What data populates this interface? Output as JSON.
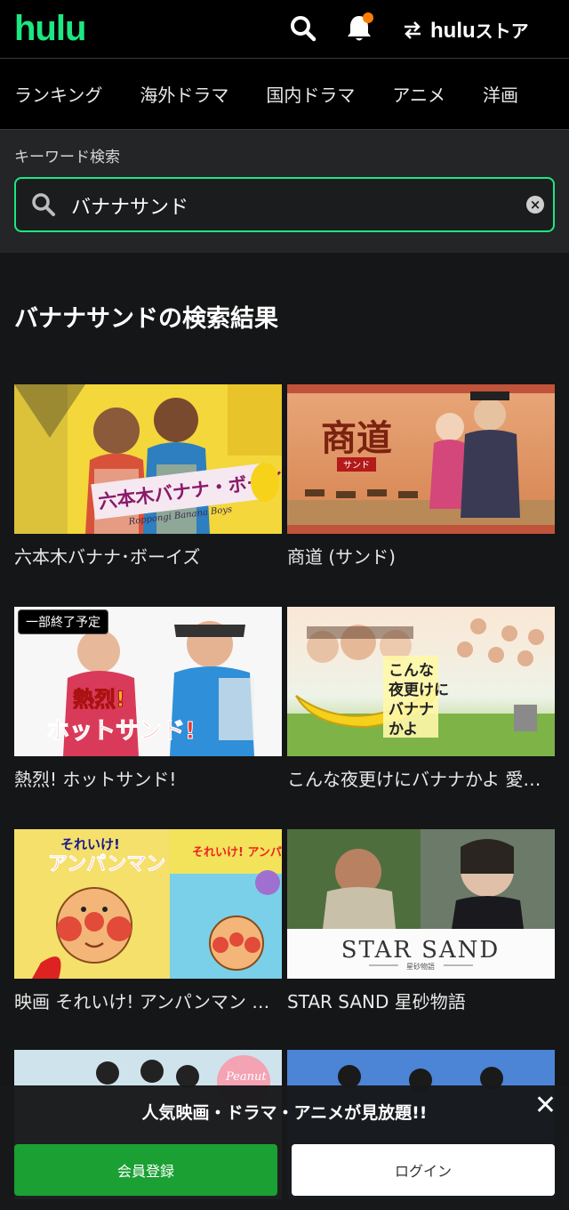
{
  "header": {
    "logo": "hulu",
    "store_label": "hulu",
    "store_suffix": "ストア"
  },
  "nav": {
    "items": [
      "ランキング",
      "海外ドラマ",
      "国内ドラマ",
      "アニメ",
      "洋画"
    ]
  },
  "search": {
    "label": "キーワード検索",
    "value": "バナナサンド"
  },
  "results": {
    "title": "バナナサンドの検索結果",
    "items": [
      {
        "title": "六本木バナナ･ボーイズ",
        "thumb_text": "六本木バナナ・ボーイズ",
        "thumb_sub": "Roppongi Banana Boys"
      },
      {
        "title": "商道 (サンド)",
        "thumb_text": "商道",
        "thumb_sub": "サンド"
      },
      {
        "title": "熱烈! ホットサンド!",
        "badge": "一部終了予定",
        "thumb_text": "ホットサンド!"
      },
      {
        "title": "こんな夜更けにバナナかよ 愛しき実話",
        "thumb_text": "こんな夜更けにバナナかよ"
      },
      {
        "title": "映画 それいけ! アンパンマン ブルブルの宝探し大冒険!",
        "thumb_text": "それいけ! アンパンマン"
      },
      {
        "title": "STAR SAND 星砂物語",
        "thumb_text": "STAR SAND",
        "thumb_sub": "星砂物語"
      },
      {
        "title": "",
        "thumb_text": "Peanut"
      },
      {
        "title": "",
        "thumb_text": ""
      }
    ]
  },
  "banner": {
    "text": "人気映画・ドラマ・アニメが見放題!!",
    "register_label": "会員登録",
    "login_label": "ログイン"
  },
  "colors": {
    "brand_green": "#1ce783",
    "register_green": "#1aa033",
    "notification_dot": "#ff7e00"
  }
}
